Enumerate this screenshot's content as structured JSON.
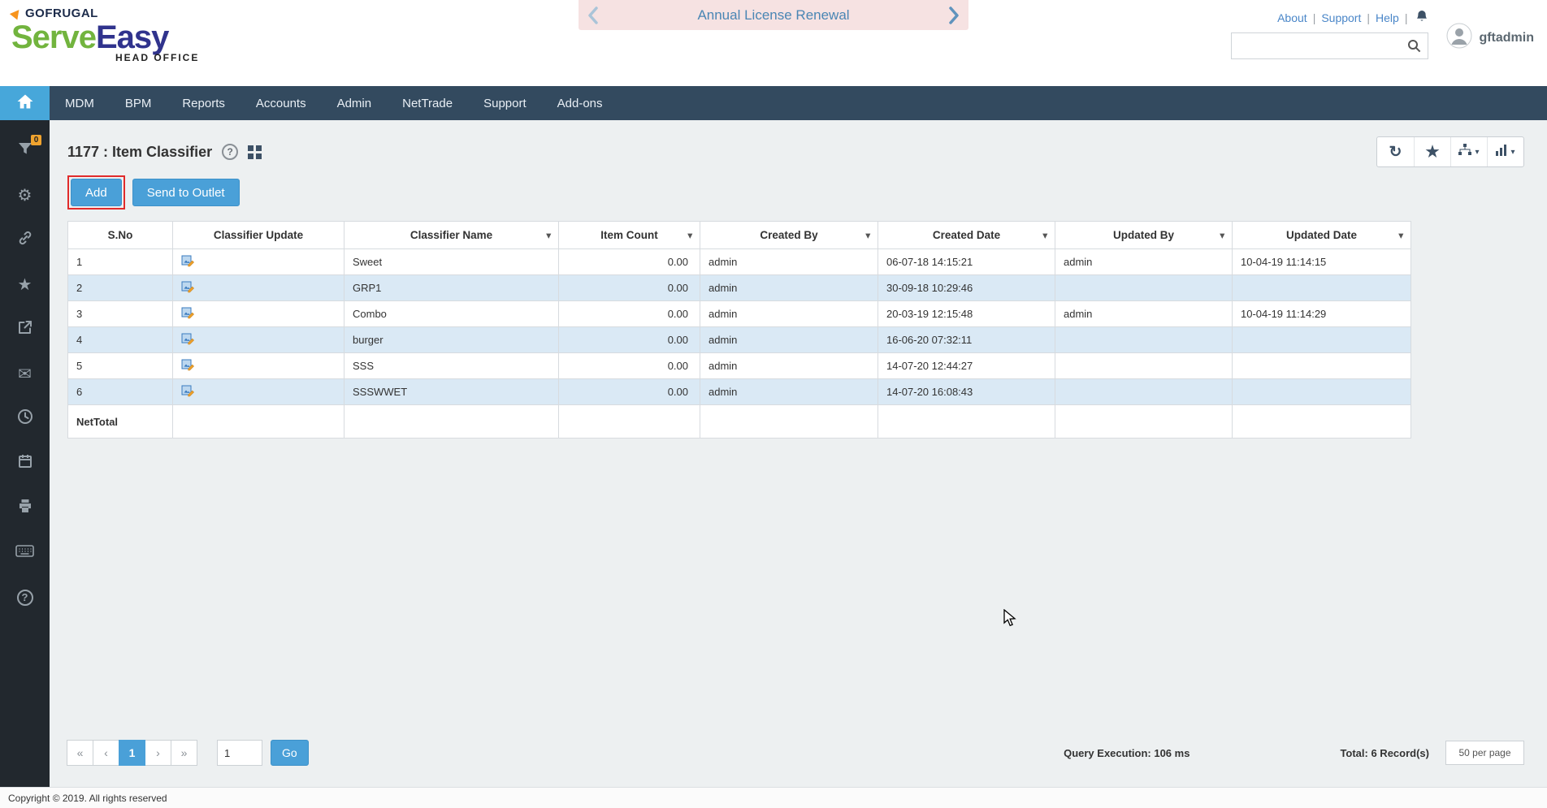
{
  "header": {
    "brand": {
      "name": "GOFRUGAL",
      "serve": "Serve",
      "easy": "Easy",
      "tagline": "HEAD OFFICE"
    },
    "banner": {
      "text": "Annual License Renewal"
    },
    "links": {
      "about": "About",
      "support": "Support",
      "help": "Help",
      "sep": "|"
    },
    "search": {
      "value": "",
      "placeholder": ""
    },
    "user": {
      "name": "gftadmin"
    }
  },
  "nav": {
    "items": [
      "MDM",
      "BPM",
      "Reports",
      "Accounts",
      "Admin",
      "NetTrade",
      "Support",
      "Add-ons"
    ]
  },
  "sidebar": {
    "filter_badge": "0"
  },
  "page": {
    "title": "1177 : Item Classifier",
    "actions": {
      "add": "Add",
      "send_to_outlet": "Send to Outlet"
    }
  },
  "table": {
    "columns": {
      "sno": "S.No",
      "classifier_update": "Classifier Update",
      "classifier_name": "Classifier Name",
      "item_count": "Item Count",
      "created_by": "Created By",
      "created_date": "Created Date",
      "updated_by": "Updated By",
      "updated_date": "Updated Date"
    },
    "rows": [
      {
        "sno": "1",
        "classifier_name": "Sweet",
        "item_count": "0.00",
        "created_by": "admin",
        "created_date": "06-07-18 14:15:21",
        "updated_by": "admin",
        "updated_date": "10-04-19 11:14:15"
      },
      {
        "sno": "2",
        "classifier_name": "GRP1",
        "item_count": "0.00",
        "created_by": "admin",
        "created_date": "30-09-18 10:29:46",
        "updated_by": "",
        "updated_date": ""
      },
      {
        "sno": "3",
        "classifier_name": "Combo",
        "item_count": "0.00",
        "created_by": "admin",
        "created_date": "20-03-19 12:15:48",
        "updated_by": "admin",
        "updated_date": "10-04-19 11:14:29"
      },
      {
        "sno": "4",
        "classifier_name": "burger",
        "item_count": "0.00",
        "created_by": "admin",
        "created_date": "16-06-20 07:32:11",
        "updated_by": "",
        "updated_date": ""
      },
      {
        "sno": "5",
        "classifier_name": "SSS",
        "item_count": "0.00",
        "created_by": "admin",
        "created_date": "14-07-20 12:44:27",
        "updated_by": "",
        "updated_date": ""
      },
      {
        "sno": "6",
        "classifier_name": "SSSWWET",
        "item_count": "0.00",
        "created_by": "admin",
        "created_date": "14-07-20 16:08:43",
        "updated_by": "",
        "updated_date": ""
      }
    ],
    "net_total_label": "NetTotal"
  },
  "pagination": {
    "first": "«",
    "prev": "‹",
    "page": "1",
    "next": "›",
    "last": "»",
    "page_input": "1",
    "go": "Go"
  },
  "status": {
    "query_execution": "Query Execution: 106 ms",
    "total": "Total: 6 Record(s)",
    "per_page": "50 per page"
  },
  "footer": {
    "copyright": "Copyright © 2019. All rights reserved"
  },
  "icons": {
    "refresh": "↻",
    "star": "★",
    "caret": "▾",
    "gear": "⚙",
    "mail": "✉",
    "help": "?"
  }
}
